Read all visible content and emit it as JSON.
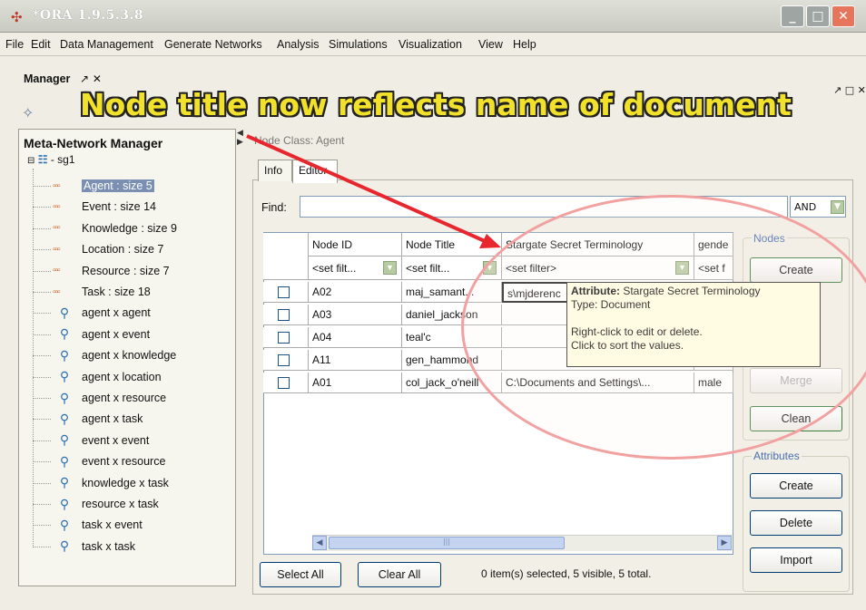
{
  "window": {
    "title": "*ORA 1.9.5.3.8",
    "app_icon": "ora-icon"
  },
  "menu": [
    "File",
    "Edit",
    "Data Management",
    "Generate Networks",
    "Analysis",
    "Simulations",
    "Visualization",
    "View",
    "Help"
  ],
  "manager": {
    "label": "Manager",
    "pin": "↗",
    "close": "✕",
    "right_controls": "↗ □ ✕"
  },
  "banner": "Node title now reflects name of document",
  "tree": {
    "title": "Meta-Network Manager",
    "root": "- sg1",
    "items": [
      {
        "label": "Agent : size 5",
        "type": "nodeset"
      },
      {
        "label": "Event : size 14",
        "type": "nodeset"
      },
      {
        "label": "Knowledge : size 9",
        "type": "nodeset"
      },
      {
        "label": "Location : size 7",
        "type": "nodeset"
      },
      {
        "label": "Resource : size 7",
        "type": "nodeset"
      },
      {
        "label": "Task : size 18",
        "type": "nodeset"
      },
      {
        "label": "agent x agent",
        "type": "network"
      },
      {
        "label": "agent x event",
        "type": "network"
      },
      {
        "label": "agent x knowledge",
        "type": "network"
      },
      {
        "label": "agent x location",
        "type": "network"
      },
      {
        "label": "agent x resource",
        "type": "network"
      },
      {
        "label": "agent x task",
        "type": "network"
      },
      {
        "label": "event x event",
        "type": "network"
      },
      {
        "label": "event x resource",
        "type": "network"
      },
      {
        "label": "knowledge x task",
        "type": "network"
      },
      {
        "label": "resource x task",
        "type": "network"
      },
      {
        "label": "task x event",
        "type": "network"
      },
      {
        "label": "task x task",
        "type": "network"
      }
    ]
  },
  "editor": {
    "node_class": "Node Class: Agent",
    "tabs": [
      "Info",
      "Editor"
    ],
    "find_label": "Find:",
    "find_value": "",
    "and_select": "AND",
    "columns": [
      "Node ID",
      "Node Title",
      "Stargate Secret Terminology",
      "gende"
    ],
    "filters": [
      "<set filt...",
      "<set filt...",
      "<set filter>",
      "<set f"
    ],
    "rows": [
      {
        "id": "A02",
        "title": "maj_samant...",
        "doc": "s\\mjderenc",
        "gender": ""
      },
      {
        "id": "A03",
        "title": "daniel_jackson",
        "doc": "",
        "gender": ""
      },
      {
        "id": "A04",
        "title": "teal'c",
        "doc": "",
        "gender": ""
      },
      {
        "id": "A11",
        "title": "gen_hammond",
        "doc": "",
        "gender": "male"
      },
      {
        "id": "A01",
        "title": "col_jack_o'neill",
        "doc": "C:\\Documents and Settings\\...",
        "gender": "male"
      }
    ],
    "select_all": "Select All",
    "clear_all": "Clear All",
    "status": "0 item(s) selected, 5 visible, 5 total."
  },
  "nodes_group": {
    "label": "Nodes",
    "create": "Create",
    "merge": "Merge",
    "clean": "Clean"
  },
  "attributes_group": {
    "label": "Attributes",
    "create": "Create",
    "delete": "Delete",
    "import": "Import"
  },
  "tooltip": {
    "attr_label": "Attribute:",
    "attr_value": "Stargate Secret Terminology",
    "type_line": "Type: Document",
    "line1": "Right-click to edit or delete.",
    "line2": "Click to sort the values."
  },
  "colors": {
    "banner": "#f2e12b",
    "arrow": "#e8262d",
    "ellipse": "#f2a1a1",
    "selection": "#7a8fb1"
  }
}
